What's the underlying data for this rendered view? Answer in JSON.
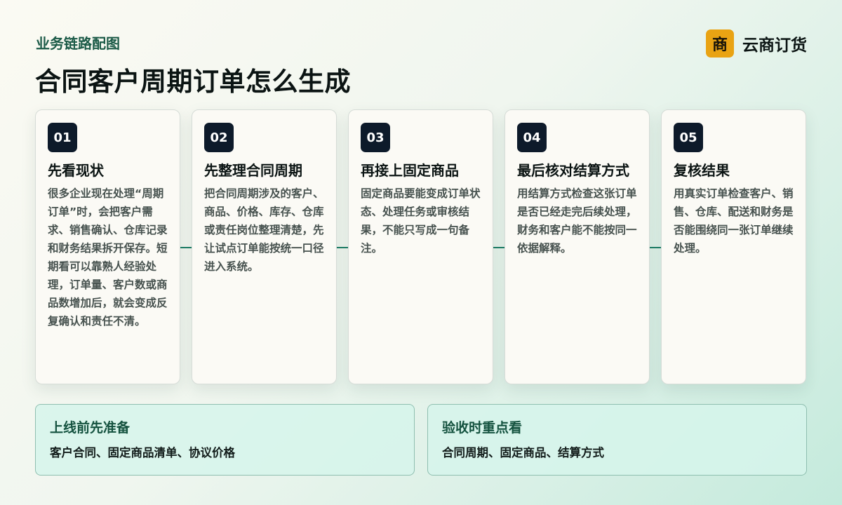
{
  "header": {
    "kicker": "业务链路配图",
    "title": "合同客户周期订单怎么生成"
  },
  "brand": {
    "logo_char": "商",
    "name": "云商订货",
    "color": "#e9a313"
  },
  "steps": [
    {
      "num": "01",
      "title": "先看现状",
      "body": "很多企业现在处理“周期订单”时，会把客户需求、销售确认、仓库记录和财务结果拆开保存。短期看可以靠熟人经验处理，订单量、客户数或商品数增加后，就会变成反复确认和责任不清。"
    },
    {
      "num": "02",
      "title": "先整理合同周期",
      "body": "把合同周期涉及的客户、商品、价格、库存、仓库或责任岗位整理清楚，先让试点订单能按统一口径进入系统。"
    },
    {
      "num": "03",
      "title": "再接上固定商品",
      "body": "固定商品要能变成订单状态、处理任务或审核结果，不能只写成一句备注。"
    },
    {
      "num": "04",
      "title": "最后核对结算方式",
      "body": "用结算方式检查这张订单是否已经走完后续处理，财务和客户能不能按同一依据解释。"
    },
    {
      "num": "05",
      "title": "复核结果",
      "body": "用真实订单检查客户、销售、仓库、配送和财务是否能围绕同一张订单继续处理。"
    }
  ],
  "panels": [
    {
      "title": "上线前先准备",
      "text": "客户合同、固定商品清单、协议价格"
    },
    {
      "title": "验收时重点看",
      "text": "合同周期、固定商品、结算方式"
    }
  ],
  "colors": {
    "accent": "#1d7e66",
    "badge": "#0d1a2a"
  }
}
